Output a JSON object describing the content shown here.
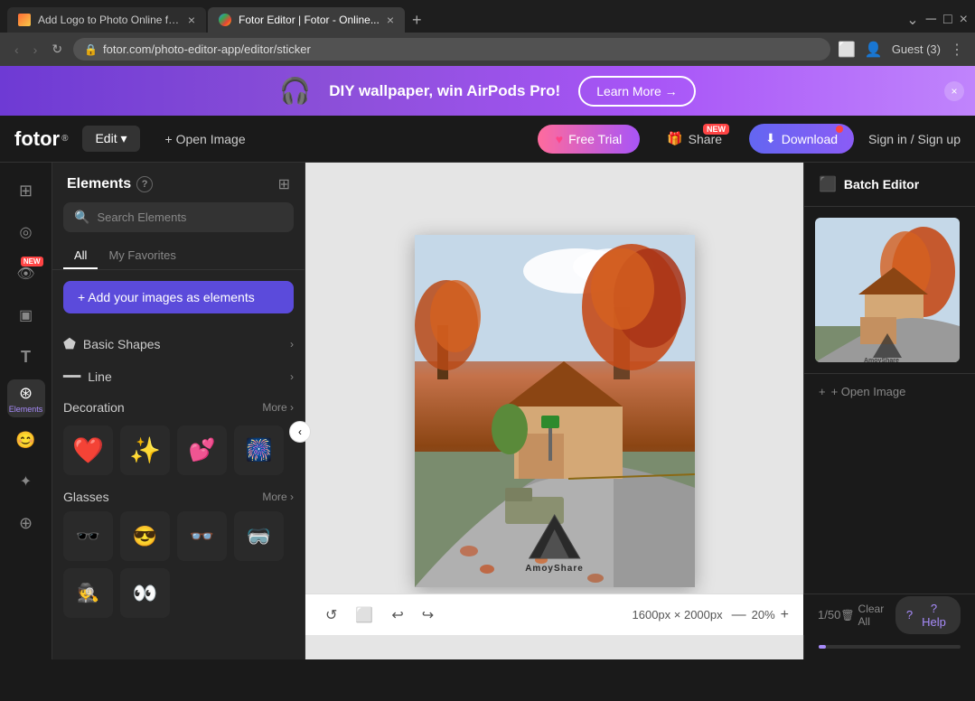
{
  "browser": {
    "tabs": [
      {
        "id": 1,
        "label": "Add Logo to Photo Online for...",
        "favicon": "orange",
        "active": false
      },
      {
        "id": 2,
        "label": "Fotor Editor | Fotor - Online...",
        "favicon": "fotor",
        "active": true
      }
    ],
    "url": "fotor.com/photo-editor-app/editor/sticker",
    "user": "Guest (3)"
  },
  "banner": {
    "text": "DIY wallpaper, win AirPods Pro!",
    "learn_more": "Learn More →",
    "airpods_emoji": "🎧"
  },
  "header": {
    "logo": "fotor",
    "logo_sup": "®",
    "edit_label": "Edit ▾",
    "open_image_label": "+ Open Image",
    "free_trial_label": "Free Trial",
    "share_label": "Share",
    "share_badge": "NEW",
    "download_label": "Download",
    "signin_label": "Sign in / Sign up"
  },
  "icon_sidebar": {
    "items": [
      {
        "id": "filter",
        "icon": "⊞",
        "label": ""
      },
      {
        "id": "beauty",
        "icon": "◎",
        "label": ""
      },
      {
        "id": "eye",
        "icon": "👁",
        "label": "",
        "badge": "NEW"
      },
      {
        "id": "frames",
        "icon": "▣",
        "label": ""
      },
      {
        "id": "text",
        "icon": "T",
        "label": ""
      },
      {
        "id": "elements",
        "icon": "⊛",
        "label": "Elements",
        "active": true
      },
      {
        "id": "stickers",
        "icon": "😊",
        "label": ""
      },
      {
        "id": "effects",
        "icon": "✦",
        "label": ""
      },
      {
        "id": "more",
        "icon": "⊕",
        "label": ""
      }
    ]
  },
  "elements_panel": {
    "title": "Elements",
    "search_placeholder": "Search Elements",
    "tabs": [
      {
        "id": "all",
        "label": "All",
        "active": true
      },
      {
        "id": "favorites",
        "label": "My Favorites",
        "active": false
      }
    ],
    "add_images_label": "+ Add your images as elements",
    "sections": {
      "basic_shapes": {
        "title": "Basic Shapes",
        "arrow": "›"
      },
      "line": {
        "title": "Line",
        "arrow": "›"
      },
      "decoration": {
        "title": "Decoration",
        "more": "More ›",
        "items": [
          "❤️",
          "✨",
          "💕",
          "🎆"
        ]
      },
      "glasses": {
        "title": "Glasses",
        "more": "More ›",
        "items": [
          "🕶️",
          "😎",
          "👓",
          "🥽",
          "🕵️",
          "👀"
        ]
      }
    }
  },
  "canvas": {
    "dimensions": "1600px × 2000px",
    "zoom": "20%",
    "page_indicator": "1/50",
    "clear_all": "Clear All"
  },
  "right_panel": {
    "batch_editor_label": "Batch Editor",
    "open_image_label": "+ Open Image",
    "help_label": "? Help"
  }
}
